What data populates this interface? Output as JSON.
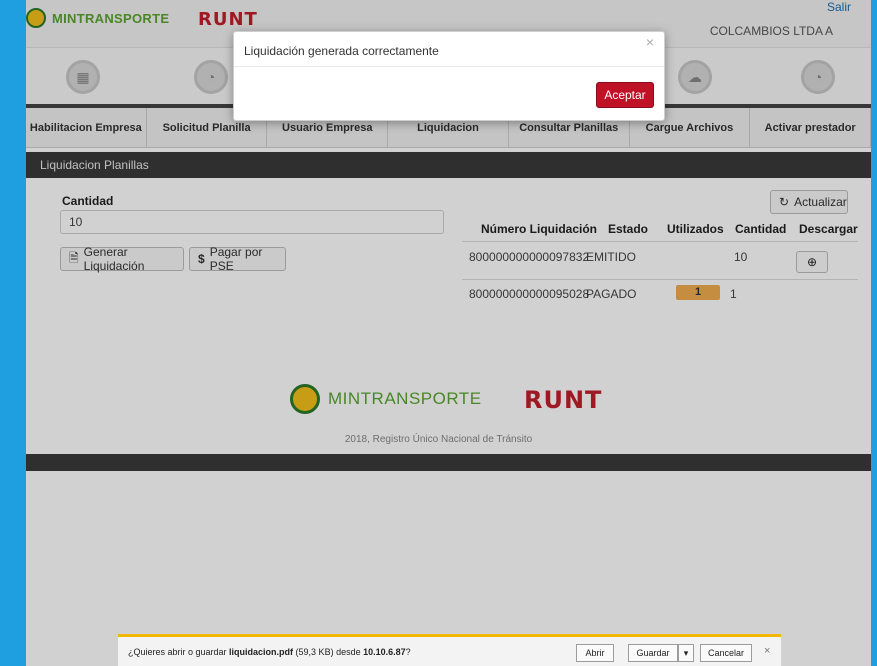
{
  "header": {
    "brand": "MINTRANSPORTE",
    "runt": "RUNT",
    "company": "COLCAMBIOS LTDA A",
    "logout": "Salir"
  },
  "nav": {
    "items": [
      "Habilitacion Empresa",
      "Solicitud Planilla",
      "Usuario Empresa",
      "Liquidacion",
      "Consultar Planillas",
      "Cargue Archivos",
      "Activar prestador"
    ]
  },
  "section": {
    "title": "Liquidacion Planillas"
  },
  "form": {
    "quantity_label": "Cantidad",
    "quantity_value": "10",
    "generate_label": "Generar Liquidación",
    "pse_label": "Pagar por PSE",
    "refresh_label": "Actualizar"
  },
  "table": {
    "headers": [
      "Número Liquidación",
      "Estado",
      "Utilizados",
      "Cantidad",
      "Descargar"
    ],
    "rows": [
      {
        "numero": "800000000000097832",
        "estado": "EMITIDO",
        "utilizados": "",
        "cantidad": "10"
      },
      {
        "numero": "800000000000095028",
        "estado": "PAGADO",
        "utilizados": "1",
        "cantidad": "1"
      }
    ]
  },
  "footer": {
    "brand": "MINTRANSPORTE",
    "runt": "RUNT",
    "copyright": "2018, Registro Único Nacional de Tránsito"
  },
  "modal": {
    "title": "Liquidación generada correctamente",
    "close": "×",
    "ok_label": "Aceptar"
  },
  "download_bar": {
    "prefix": "¿Quieres abrir o guardar ",
    "filename": "liquidacion.pdf",
    "size": " (59,3 KB) desde ",
    "host": "10.10.6.87",
    "suffix": "?",
    "open_label": "Abrir",
    "save_label": "Guardar",
    "cancel_label": "Cancelar",
    "close": "×"
  },
  "colors": {
    "frame": "#1f9fe0",
    "accent_red": "#c01227",
    "brand_green": "#5aa52f",
    "badge": "#f0ad4e"
  }
}
